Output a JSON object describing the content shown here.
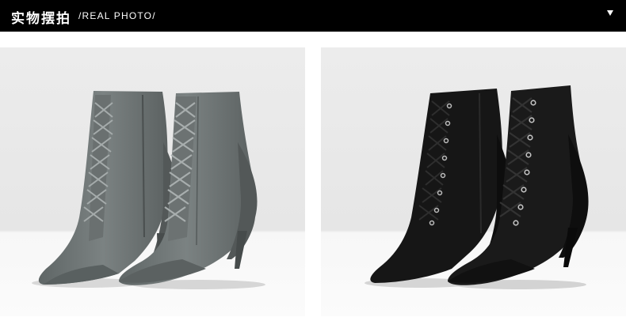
{
  "header": {
    "title_cn": "实物摆拍",
    "title_en": "/REAL PHOTO/",
    "toggle_icon": "caret-down-icon"
  },
  "photos": [
    {
      "name": "grey-boots-photo",
      "boot_color": "#6f7575",
      "lace_color": "#9aa0a0"
    },
    {
      "name": "black-boots-photo",
      "boot_color": "#141414",
      "lace_color": "#3a3a3a"
    }
  ]
}
